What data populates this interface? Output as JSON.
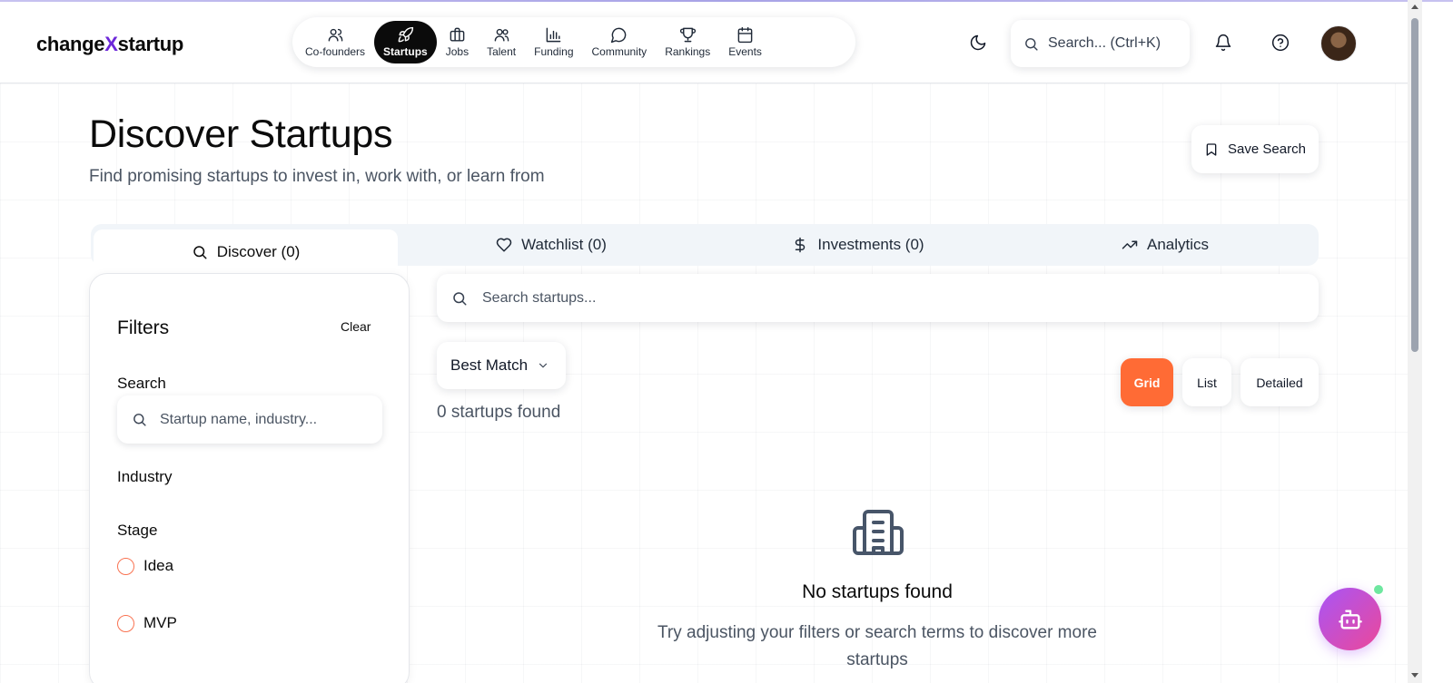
{
  "header": {
    "logo_prefix": "change",
    "logo_x": "X",
    "logo_suffix": "startup",
    "nav": [
      {
        "label": "Co-founders",
        "icon": "users-icon"
      },
      {
        "label": "Startups",
        "icon": "rocket-icon",
        "active": true
      },
      {
        "label": "Jobs",
        "icon": "briefcase-icon"
      },
      {
        "label": "Talent",
        "icon": "user-group-icon"
      },
      {
        "label": "Funding",
        "icon": "bar-chart-icon"
      },
      {
        "label": "Community",
        "icon": "chat-bubble-icon"
      },
      {
        "label": "Rankings",
        "icon": "trophy-icon"
      },
      {
        "label": "Events",
        "icon": "calendar-icon"
      }
    ],
    "search_placeholder": "Search... (Ctrl+K)",
    "theme_icon": "moon-icon",
    "notification_icon": "bell-icon",
    "help_icon": "help-circle-icon"
  },
  "page": {
    "title": "Discover Startups",
    "subtitle": "Find promising startups to invest in, work with, or learn from",
    "save_search_label": "Save Search"
  },
  "tabs": [
    {
      "label": "Discover (0)",
      "icon": "search-icon",
      "active": true
    },
    {
      "label": "Watchlist (0)",
      "icon": "heart-icon"
    },
    {
      "label": "Investments (0)",
      "icon": "dollar-icon"
    },
    {
      "label": "Analytics",
      "icon": "trending-up-icon"
    }
  ],
  "filters": {
    "title": "Filters",
    "clear_label": "Clear",
    "search_label": "Search",
    "search_placeholder": "Startup name, industry...",
    "industry_label": "Industry",
    "stage_label": "Stage",
    "stages": [
      "Idea",
      "MVP"
    ]
  },
  "main": {
    "search_placeholder": "Search startups...",
    "sort_value": "Best Match",
    "count_text": "0 startups found",
    "view_modes": [
      {
        "label": "Grid",
        "active": true
      },
      {
        "label": "List"
      },
      {
        "label": "Detailed"
      }
    ],
    "empty_title": "No startups found",
    "empty_description": "Try adjusting your filters or search terms to discover more startups"
  },
  "colors": {
    "accent": "#ff6b35",
    "radio_border": "#f97352",
    "bot_gradient_start": "#a855f7",
    "bot_gradient_end": "#ec4899",
    "online_dot": "#6ee7a0"
  }
}
